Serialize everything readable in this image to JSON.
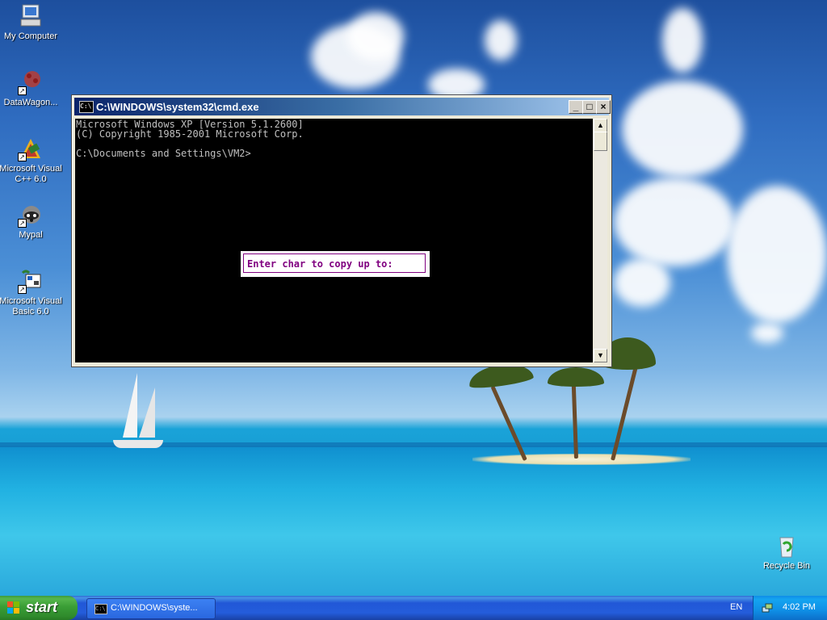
{
  "desktop": {
    "icons": [
      {
        "label": "My Computer",
        "icon": "my-computer-icon"
      },
      {
        "label": "DataWagon...",
        "icon": "datawagon-icon"
      },
      {
        "label": "Microsoft Visual C++ 6.0",
        "icon": "visual-cpp-icon"
      },
      {
        "label": "Mypal",
        "icon": "mypal-icon"
      },
      {
        "label": "Microsoft Visual Basic 6.0",
        "icon": "visual-basic-icon"
      },
      {
        "label": "Recycle Bin",
        "icon": "recycle-bin-icon"
      }
    ]
  },
  "cmd_window": {
    "title": "C:\\WINDOWS\\system32\\cmd.exe",
    "icon_text": "C:\\",
    "minimize_glyph": "_",
    "maximize_glyph": "□",
    "close_glyph": "×",
    "lines": [
      "Microsoft Windows XP [Version 5.1.2600]",
      "(C) Copyright 1985-2001 Microsoft Corp.",
      "",
      "C:\\Documents and Settings\\VM2>"
    ],
    "prompt_box_text": "Enter char to copy up to:",
    "scroll_up_glyph": "▲",
    "scroll_down_glyph": "▼"
  },
  "taskbar": {
    "start_label": "start",
    "task_button_label": "C:\\WINDOWS\\syste...",
    "task_icon_text": "C:\\",
    "language": "EN",
    "clock": "4:02 PM"
  },
  "colors": {
    "prompt_text": "#800080",
    "console_text": "#c0c0c0",
    "titlebar_start": "#0a246a"
  }
}
